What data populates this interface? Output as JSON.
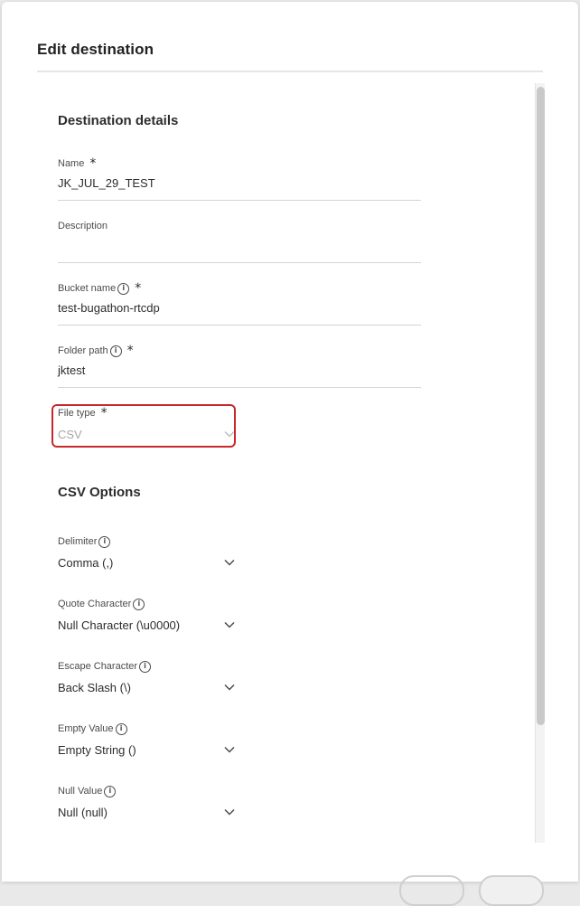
{
  "dialog": {
    "title": "Edit destination"
  },
  "destination_details": {
    "title": "Destination details",
    "name": {
      "label": "Name",
      "value": "JK_JUL_29_TEST",
      "required": "*"
    },
    "description": {
      "label": "Description",
      "value": ""
    },
    "bucket_name": {
      "label": "Bucket name",
      "value": "test-bugathon-rtcdp",
      "required": "*"
    },
    "folder_path": {
      "label": "Folder path",
      "value": "jktest",
      "required": "*"
    },
    "file_type": {
      "label": "File type",
      "value": "CSV",
      "required": "*",
      "highlight_color": "#c8282b"
    }
  },
  "csv_options": {
    "title": "CSV Options",
    "delimiter": {
      "label": "Delimiter",
      "value": "Comma (,)"
    },
    "quote_character": {
      "label": "Quote Character",
      "value": "Null Character (\\u0000)"
    },
    "escape_character": {
      "label": "Escape Character",
      "value": "Back Slash (\\)"
    },
    "empty_value": {
      "label": "Empty Value",
      "value": "Empty String ()"
    },
    "null_value": {
      "label": "Null Value",
      "value": "Null (null)"
    }
  },
  "icons": {
    "info": "info-icon",
    "chevron": "chevron-down-icon"
  },
  "info_glyph": "i"
}
